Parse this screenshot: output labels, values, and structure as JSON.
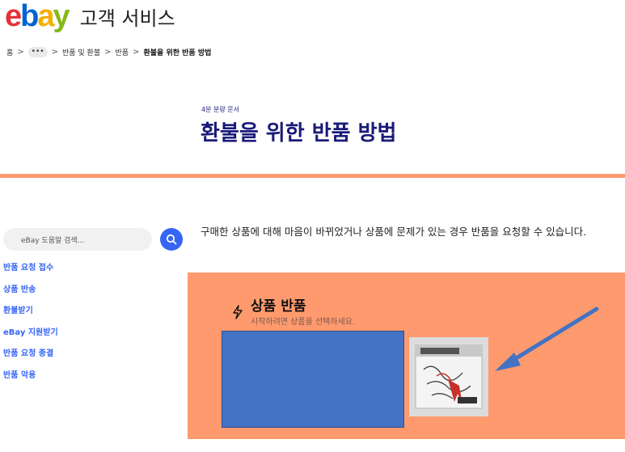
{
  "brand": {
    "logo_letters": [
      "e",
      "b",
      "a",
      "y"
    ],
    "logo_colors": [
      "#e53238",
      "#0064d2",
      "#f5af02",
      "#86b817"
    ],
    "page_title": "고객 서비스"
  },
  "breadcrumb": {
    "items": [
      "홈",
      "•••",
      "반품 및 환불",
      "반품"
    ],
    "current": "환불을 위한 반품 방법",
    "separator": ">"
  },
  "article": {
    "meta": "4분 분량 문서",
    "title": "환불을 위한 반품 방법",
    "intro": "구매한 상품에 대해 마음이 바뀌었거나 상품에 문제가 있는 경우 반품을 요청할 수 있습니다."
  },
  "search": {
    "placeholder": "eBay 도움말 검색...",
    "icon": "search-icon"
  },
  "sidebar": {
    "items": [
      "반품 요청 접수",
      "상품 반송",
      "환불받기",
      "eBay 지원받기",
      "반품 요청 종결",
      "반품 악용"
    ]
  },
  "card": {
    "icon": "lightning-icon",
    "title": "상품 반품",
    "subtitle": "시작하려면 상품을 선택하세요."
  },
  "colors": {
    "accent": "#ff9a6e",
    "link": "#3665f3",
    "title": "#1a1a7a",
    "blue_box": "#4472c4"
  }
}
